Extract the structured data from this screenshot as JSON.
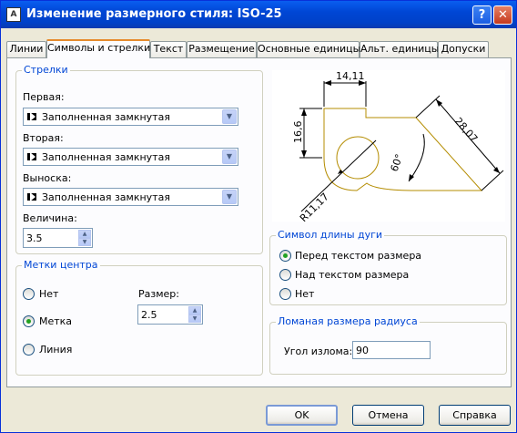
{
  "window": {
    "title": "Изменение размерного стиля: ISO-25",
    "help_label": "?",
    "close_label": "✕",
    "icon": "autocad-app-icon"
  },
  "tabs": [
    {
      "label": "Линии"
    },
    {
      "label": "Символы и стрелки",
      "active": true
    },
    {
      "label": "Текст"
    },
    {
      "label": "Размещение"
    },
    {
      "label": "Основные единицы"
    },
    {
      "label": "Альт. единицы"
    },
    {
      "label": "Допуски"
    }
  ],
  "arrows": {
    "title": "Стрелки",
    "first_label": "Первая:",
    "first_value": "Заполненная замкнутая",
    "second_label": "Вторая:",
    "second_value": "Заполненная замкнутая",
    "leader_label": "Выноска:",
    "leader_value": "Заполненная замкнутая",
    "size_label": "Величина:",
    "size_value": "3.5"
  },
  "center_marks": {
    "title": "Метки центра",
    "options": [
      "Нет",
      "Метка",
      "Линия"
    ],
    "selected": "Метка",
    "size_label": "Размер:",
    "size_value": "2.5"
  },
  "preview": {
    "dim_top": "14,11",
    "dim_left": "16,6",
    "dim_right": "28,07",
    "dim_angle": "60°",
    "dim_radius": "R11,17"
  },
  "arc_symbol": {
    "title": "Символ длины дуги",
    "options": [
      "Перед текстом размера",
      "Над текстом размера",
      "Нет"
    ],
    "selected": "Перед текстом размера"
  },
  "jog": {
    "title": "Ломаная размера радиуса",
    "angle_label": "Угол излома:",
    "angle_value": "90"
  },
  "buttons": {
    "ok": "OK",
    "cancel": "Отмена",
    "help": "Справка"
  }
}
